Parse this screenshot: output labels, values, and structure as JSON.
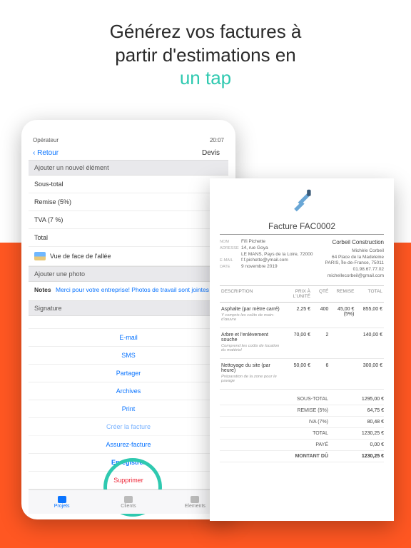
{
  "hero": {
    "line1": "Générez vos factures à",
    "line2": "partir d'estimations en",
    "accent": "un tap"
  },
  "tablet": {
    "status": {
      "carrier": "Opérateur",
      "time": "20:07"
    },
    "back": "Retour",
    "navTitle": "Devis",
    "addElement": "Ajouter un nouvel élément",
    "lines": {
      "subtotal": "Sous-total",
      "discount": "Remise (5%)",
      "tva": "TVA (7 %)",
      "total": "Total"
    },
    "photoCaption": "Vue de face de l'allée",
    "addPhoto": "Ajouter une photo",
    "notesLabel": "Notes",
    "notesText": "Merci pour votre entreprise! Photos de travail sont jointes e",
    "signature": "Signature",
    "actions": {
      "email": "E-mail",
      "sms": "SMS",
      "share": "Partager",
      "archive": "Archives",
      "print": "Print",
      "modifyInvoice": "Créer la facture",
      "assure": "Assurez-facture",
      "save": "Enregistrer",
      "delete": "Supprimer"
    },
    "tabs": {
      "projets": "Projets",
      "clients": "Clients",
      "elements": "Elements"
    }
  },
  "invoice": {
    "title": "Facture FAC0002",
    "from": {
      "nomLbl": "NOM",
      "nom": "Fifi Pichette",
      "adrLbl": "ADRESSE",
      "adr1": "14, rue Goya",
      "adr2": "LE MANS, Pays de la Loire, 72000",
      "emlLbl": "E-MAIL",
      "eml": "f.f.pichette@ymail.com",
      "dateLbl": "DATE",
      "date": "9 novembre 2019"
    },
    "to": {
      "company": "Corbeil Construction",
      "name": "Michèle Corbeil",
      "adr1": "64 Place de la Madeleine",
      "adr2": "PARIS, Île-de-France, 75011",
      "phone": "01.98.67.77.02",
      "email": "michellecorbeil@gmail.com"
    },
    "cols": {
      "desc": "DESCRIPTION",
      "pu": "PRIX À L'UNITÉ",
      "qte": "QTÉ",
      "rem": "REMISE",
      "tot": "TOTAL"
    },
    "items": [
      {
        "desc": "Asphalte (par mètre carré)",
        "sub": "Y compris les coûts de main-d'œuvre",
        "pu": "2,25 €",
        "qte": "400",
        "rem": "45,00 € (5%)",
        "tot": "855,00 €"
      },
      {
        "desc": "Arbre et l'enlèvement souche",
        "sub": "Comprend les coûts de location du matériel",
        "pu": "70,00 €",
        "qte": "2",
        "rem": "",
        "tot": "140,00 €"
      },
      {
        "desc": "Nettoyage du site (par heure)",
        "sub": "Préparation de la zone pour le pavage",
        "pu": "50,00 €",
        "qte": "6",
        "rem": "",
        "tot": "300,00 €"
      }
    ],
    "totals": [
      {
        "label": "SOUS-TOTAL",
        "value": "1295,00 €"
      },
      {
        "label": "REMISE (5%)",
        "value": "64,75 €"
      },
      {
        "label": "IVA (7%)",
        "value": "80,48 €"
      },
      {
        "label": "TOTAL",
        "value": "1230,25 €"
      },
      {
        "label": "PAYÉ",
        "value": "0,00 €"
      },
      {
        "label": "MONTANT DÛ",
        "value": "1230,25 €",
        "strong": true
      }
    ]
  }
}
